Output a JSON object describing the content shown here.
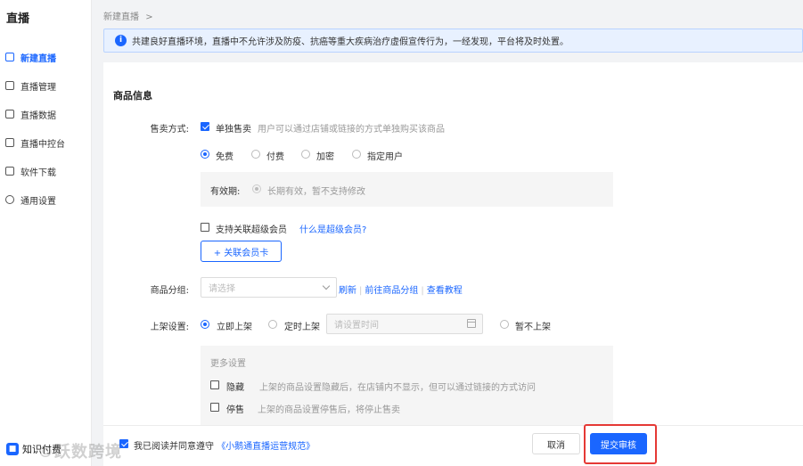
{
  "sidebar": {
    "title": "直播",
    "items": [
      {
        "label": "新建直播",
        "icon": "live-add-icon",
        "active": true
      },
      {
        "label": "直播管理",
        "icon": "list-icon"
      },
      {
        "label": "直播数据",
        "icon": "data-icon"
      },
      {
        "label": "直播中控台",
        "icon": "monitor-icon"
      },
      {
        "label": "软件下载",
        "icon": "download-icon"
      },
      {
        "label": "通用设置",
        "icon": "gear-icon"
      }
    ],
    "bottom": {
      "label": "知识付费",
      "icon": "app-logo-icon"
    },
    "watermark": "©跃数跨境"
  },
  "breadcrumb": {
    "current": "新建直播",
    "separator": ">"
  },
  "notice": {
    "icon": "info-icon",
    "text": "共建良好直播环境，直播中不允许涉及防疫、抗癌等重大疾病治疗虚假宣传行为，一经发现，平台将及时处置。"
  },
  "section_title": "商品信息",
  "sale": {
    "label": "售卖方式:",
    "single_checked": true,
    "single_label": "单独售卖",
    "single_desc": "用户可以通过店铺或链接的方式单独购买该商品",
    "pricing_options": [
      "免费",
      "付费",
      "加密",
      "指定用户"
    ],
    "pricing_selected": "免费",
    "validity_label": "有效期:",
    "validity_value": "长期有效，暂不支持修改",
    "member_checked": false,
    "member_label": "支持关联超级会员",
    "member_link": "什么是超级会员?",
    "link_card_button": "+ 关联会员卡"
  },
  "group": {
    "label": "商品分组:",
    "placeholder": "请选择",
    "links": [
      "刷新",
      "前往商品分组",
      "查看教程"
    ]
  },
  "shelf": {
    "label": "上架设置:",
    "options": [
      "立即上架",
      "定时上架",
      "暂不上架"
    ],
    "selected": "立即上架",
    "time_placeholder": "请设置时间",
    "more_title": "更多设置",
    "more_items": [
      {
        "label": "隐藏",
        "desc": "上架的商品设置隐藏后，在店铺内不显示，但可以通过链接的方式访问",
        "checked": false
      },
      {
        "label": "停售",
        "desc": "上架的商品设置停售后，将停止售卖",
        "checked": false
      }
    ]
  },
  "footer": {
    "agree_checked": true,
    "agree_text": "我已阅读并同意遵守",
    "agree_link": "《小鹅通直播运营规范》",
    "cancel": "取消",
    "submit": "提交审核"
  },
  "colors": {
    "accent": "#1a66ff",
    "highlight": "#e53935",
    "notice_bg": "#e8f1ff"
  }
}
